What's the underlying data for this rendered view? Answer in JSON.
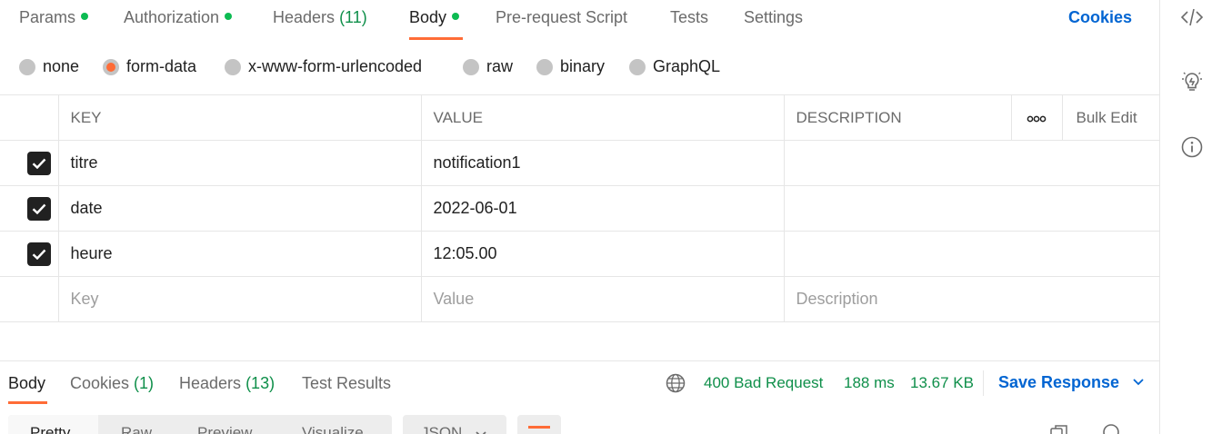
{
  "request_tabs": [
    {
      "label": "Params",
      "count": "",
      "dot": true
    },
    {
      "label": "Authorization",
      "count": "",
      "dot": true
    },
    {
      "label": "Headers",
      "count": "(11)",
      "dot": false
    },
    {
      "label": "Body",
      "count": "",
      "dot": true
    },
    {
      "label": "Pre-request Script",
      "count": "",
      "dot": false
    },
    {
      "label": "Tests",
      "count": "",
      "dot": false
    },
    {
      "label": "Settings",
      "count": "",
      "dot": false
    }
  ],
  "active_request_tab": "Body",
  "cookies_link": "Cookies",
  "body_types": [
    {
      "label": "none",
      "selected": false
    },
    {
      "label": "form-data",
      "selected": true
    },
    {
      "label": "x-www-form-urlencoded",
      "selected": false
    },
    {
      "label": "raw",
      "selected": false
    },
    {
      "label": "binary",
      "selected": false
    },
    {
      "label": "GraphQL",
      "selected": false
    }
  ],
  "table": {
    "headers": {
      "key": "KEY",
      "value": "VALUE",
      "description": "DESCRIPTION",
      "bulk_edit": "Bulk Edit"
    },
    "rows": [
      {
        "checked": true,
        "key": "titre",
        "value": "notification1",
        "description": ""
      },
      {
        "checked": true,
        "key": "date",
        "value": "2022-06-01",
        "description": ""
      },
      {
        "checked": true,
        "key": "heure",
        "value": "12:05.00",
        "description": ""
      }
    ],
    "placeholders": {
      "key": "Key",
      "value": "Value",
      "description": "Description"
    }
  },
  "response_tabs": [
    {
      "label": "Body",
      "count": ""
    },
    {
      "label": "Cookies",
      "count": "(1)"
    },
    {
      "label": "Headers",
      "count": "(13)"
    },
    {
      "label": "Test Results",
      "count": ""
    }
  ],
  "active_response_tab": "Body",
  "response_status": {
    "status": "400 Bad Request",
    "time": "188 ms",
    "size": "13.67 KB"
  },
  "save_response": "Save Response",
  "view_modes": [
    "Pretty",
    "Raw",
    "Preview",
    "Visualize"
  ],
  "format": "JSON",
  "colors": {
    "accent": "#ff6c37",
    "link": "#0265d2",
    "success": "#0f8f4a",
    "dot": "#0cbb52"
  },
  "sidebar_icons": [
    "code-icon",
    "lightbulb-icon",
    "info-icon"
  ]
}
